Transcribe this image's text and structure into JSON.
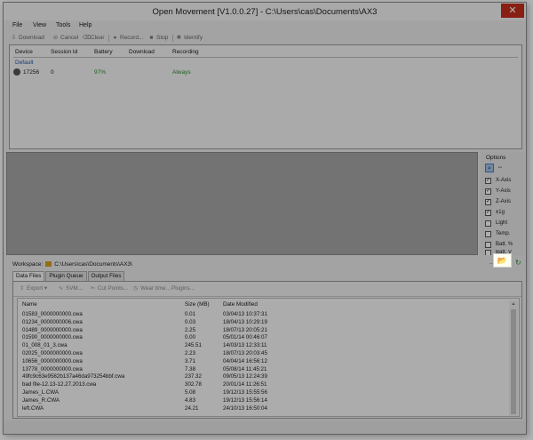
{
  "window": {
    "title": "Open Movement  [V1.0.0.27]  -  C:\\Users\\cas\\Documents\\AX3",
    "close_label": "✕"
  },
  "menu": [
    "File",
    "View",
    "Tools",
    "Help"
  ],
  "toolbar": {
    "download": "Download",
    "cancel": "Cancel",
    "clear": "Clear",
    "record": "Record...",
    "stop": "Stop",
    "identify": "Identify"
  },
  "devices": {
    "columns": [
      "Device",
      "Session Id",
      "Battery",
      "Download",
      "Recording"
    ],
    "group": "Default",
    "rows": [
      {
        "device": "17256",
        "session": "0",
        "battery": "97%",
        "download": "",
        "recording": "Always"
      }
    ]
  },
  "options": {
    "title": "Options",
    "items": [
      {
        "label": "X-Axis",
        "checked": true
      },
      {
        "label": "Y-Axis",
        "checked": true
      },
      {
        "label": "Z-Axis",
        "checked": true
      },
      {
        "label": "±1g",
        "checked": true
      },
      {
        "label": "Light",
        "checked": false
      },
      {
        "label": "Temp.",
        "checked": false
      },
      {
        "label": "Batt. %",
        "checked": false
      },
      {
        "label": "Batt. V",
        "checked": false
      }
    ]
  },
  "workspace": {
    "label": "Workspace:",
    "path": "C:\\Users\\cas\\Documents\\AX3\\",
    "dots": "...",
    "open_folder_icon": "📂",
    "refresh_icon": "↻"
  },
  "tabs": [
    "Data Files",
    "Plugin Queue",
    "Output Files"
  ],
  "files_toolbar": {
    "export": "Export",
    "svm": "SVM...",
    "cut_points": "Cut Points...",
    "wear_time": "Wear time...",
    "plugins": "Plugins..."
  },
  "files": {
    "columns": [
      "Name",
      "Size (MB)",
      "Date Modified"
    ],
    "rows": [
      [
        "01583_0000000000.cwa",
        "0.01",
        "03/04/13 10:37:31"
      ],
      [
        "01234_0000000006.cwa",
        "0.03",
        "18/04/13 10:29:19"
      ],
      [
        "01489_0000000000.cwa",
        "2.25",
        "18/07/13 20:05:21"
      ],
      [
        "01590_0000000000.cwa",
        "0.00",
        "05/01/14 00:46:07"
      ],
      [
        "01_008_01_3.cwa",
        "245.51",
        "14/03/13 12:33:11"
      ],
      [
        "02025_0000000000.cwa",
        "2.23",
        "18/07/13 20:03:45"
      ],
      [
        "10656_0000000000.cwa",
        "3.71",
        "04/04/14 16:56:12"
      ],
      [
        "13778_0000000000.cwa",
        "7.38",
        "05/08/14 11:45:21"
      ],
      [
        "49fc9c63e9582b137a46da973254bbf.cwa",
        "237.32",
        "09/05/13 12:24:39"
      ],
      [
        "bad file-12.13-12.27.2013.cwa",
        "302.78",
        "20/01/14 11:26:51"
      ],
      [
        "James_L.CWA",
        "5.08",
        "19/12/13 15:55:56"
      ],
      [
        "James_R.CWA",
        "4.83",
        "19/12/13 15:56:14"
      ],
      [
        "left.CWA",
        "24.21",
        "24/10/13 16:50:04"
      ]
    ]
  }
}
